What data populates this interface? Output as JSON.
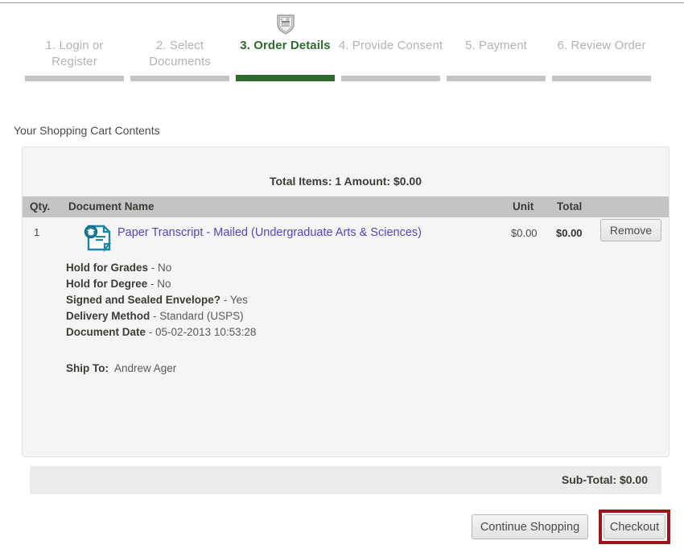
{
  "stepper": {
    "logo_name": "university-crest-logo",
    "current_step_index": 2,
    "steps": [
      {
        "label": "1. Login or Register",
        "state": "inactive"
      },
      {
        "label": "2. Select Documents",
        "state": "inactive"
      },
      {
        "label": "3. Order Details",
        "state": "current"
      },
      {
        "label": "4. Provide Consent",
        "state": "inactive"
      },
      {
        "label": "5. Payment",
        "state": "inactive"
      },
      {
        "label": "6. Review Order",
        "state": "inactive"
      }
    ]
  },
  "cart": {
    "heading": "Your Shopping Cart Contents",
    "totals_line": "Total Items: 1  Amount: $0.00",
    "columns": {
      "qty": "Qty.",
      "document_name": "Document Name",
      "unit": "Unit",
      "total": "Total"
    },
    "item": {
      "qty": "1",
      "icon_name": "transcript-document-icon",
      "name": "Paper Transcript - Mailed (Undergraduate Arts & Sciences)",
      "unit": "$0.00",
      "total": "$0.00",
      "remove_label": "Remove",
      "options": [
        {
          "label": "Hold for Grades",
          "value": "No"
        },
        {
          "label": "Hold for Degree",
          "value": "No"
        },
        {
          "label": "Signed and Sealed Envelope?",
          "value": "Yes"
        },
        {
          "label": "Delivery Method",
          "value": "Standard (USPS)"
        },
        {
          "label": "Document Date",
          "value": "05-02-2013 10:53:28"
        }
      ],
      "ship_to_label": "Ship To:",
      "ship_to_name": "Andrew Ager"
    },
    "subtotal": "Sub-Total: $0.00"
  },
  "actions": {
    "continue_shopping": "Continue Shopping",
    "checkout": "Checkout"
  },
  "colors": {
    "accent_green": "#2f6b2a",
    "link_purple": "#5b3fc4",
    "highlight_red": "#a21219",
    "header_gray": "#c4c4c4"
  }
}
